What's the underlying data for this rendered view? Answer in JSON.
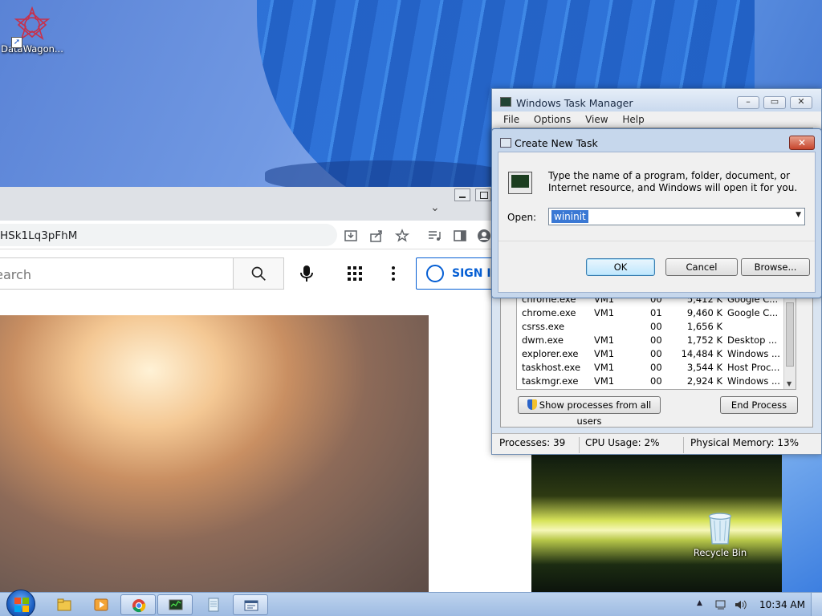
{
  "desktop": {
    "icons": [
      {
        "label": "DataWagon...",
        "icon": "datawagon-icon"
      },
      {
        "label": "Recycle Bin",
        "icon": "recycle-bin-icon"
      }
    ]
  },
  "browser": {
    "url": "HSk1Lq3pFhM",
    "youtube": {
      "search_placeholder": "Search",
      "signin_label": "SIGN IN"
    }
  },
  "task_manager": {
    "title": "Windows Task Manager",
    "menu": [
      "File",
      "Options",
      "View",
      "Help"
    ],
    "processes": [
      {
        "name": "chrome.exe",
        "user": "VM1",
        "cpu": "00",
        "mem": "5,412 K",
        "desc": "Google C..."
      },
      {
        "name": "chrome.exe",
        "user": "VM1",
        "cpu": "01",
        "mem": "9,460 K",
        "desc": "Google C..."
      },
      {
        "name": "csrss.exe",
        "user": "",
        "cpu": "00",
        "mem": "1,656 K",
        "desc": ""
      },
      {
        "name": "dwm.exe",
        "user": "VM1",
        "cpu": "00",
        "mem": "1,752 K",
        "desc": "Desktop ..."
      },
      {
        "name": "explorer.exe",
        "user": "VM1",
        "cpu": "00",
        "mem": "14,484 K",
        "desc": "Windows ..."
      },
      {
        "name": "taskhost.exe",
        "user": "VM1",
        "cpu": "00",
        "mem": "3,544 K",
        "desc": "Host Proc..."
      },
      {
        "name": "taskmgr.exe",
        "user": "VM1",
        "cpu": "00",
        "mem": "2,924 K",
        "desc": "Windows ..."
      }
    ],
    "show_all_label": "Show processes from all users",
    "end_process_label": "End Process",
    "status": {
      "processes": "Processes: 39",
      "cpu": "CPU Usage: 2%",
      "memory": "Physical Memory: 13%"
    }
  },
  "new_task": {
    "title": "Create New Task",
    "description": "Type the name of a program, folder, document, or Internet resource, and Windows will open it for you.",
    "open_label": "Open:",
    "open_value": "wininit",
    "ok_label": "OK",
    "cancel_label": "Cancel",
    "browse_label": "Browse..."
  },
  "taskbar": {
    "clock": "10:34 AM",
    "pinned": [
      "explorer-icon",
      "media-player-icon",
      "chrome-icon",
      "taskmgr-icon",
      "notepad-icon",
      "run-dialog-icon"
    ]
  },
  "colors": {
    "accent": "#065fd4",
    "selection": "#3a78d4",
    "taskbar": "#a9c3e6"
  }
}
